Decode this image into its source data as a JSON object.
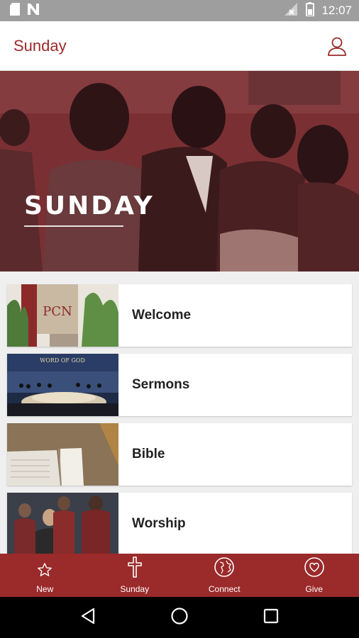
{
  "status_bar": {
    "time": "12:07"
  },
  "app_bar": {
    "title": "Sunday"
  },
  "hero": {
    "heading": "SUNDAY"
  },
  "list": {
    "items": [
      {
        "label": "Welcome",
        "thumb_sign": "PCN"
      },
      {
        "label": "Sermons",
        "thumb_sign": "WORD OF GOD"
      },
      {
        "label": "Bible"
      },
      {
        "label": "Worship"
      }
    ]
  },
  "tabs": [
    {
      "label": "New",
      "icon": "star-icon"
    },
    {
      "label": "Sunday",
      "icon": "cross-icon"
    },
    {
      "label": "Connect",
      "icon": "globe-icon"
    },
    {
      "label": "Give",
      "icon": "heart-icon"
    }
  ],
  "colors": {
    "brand": "#9b2a2a",
    "status_bar": "#9e9e9e",
    "hero_overlay": "#6e2a2c"
  }
}
